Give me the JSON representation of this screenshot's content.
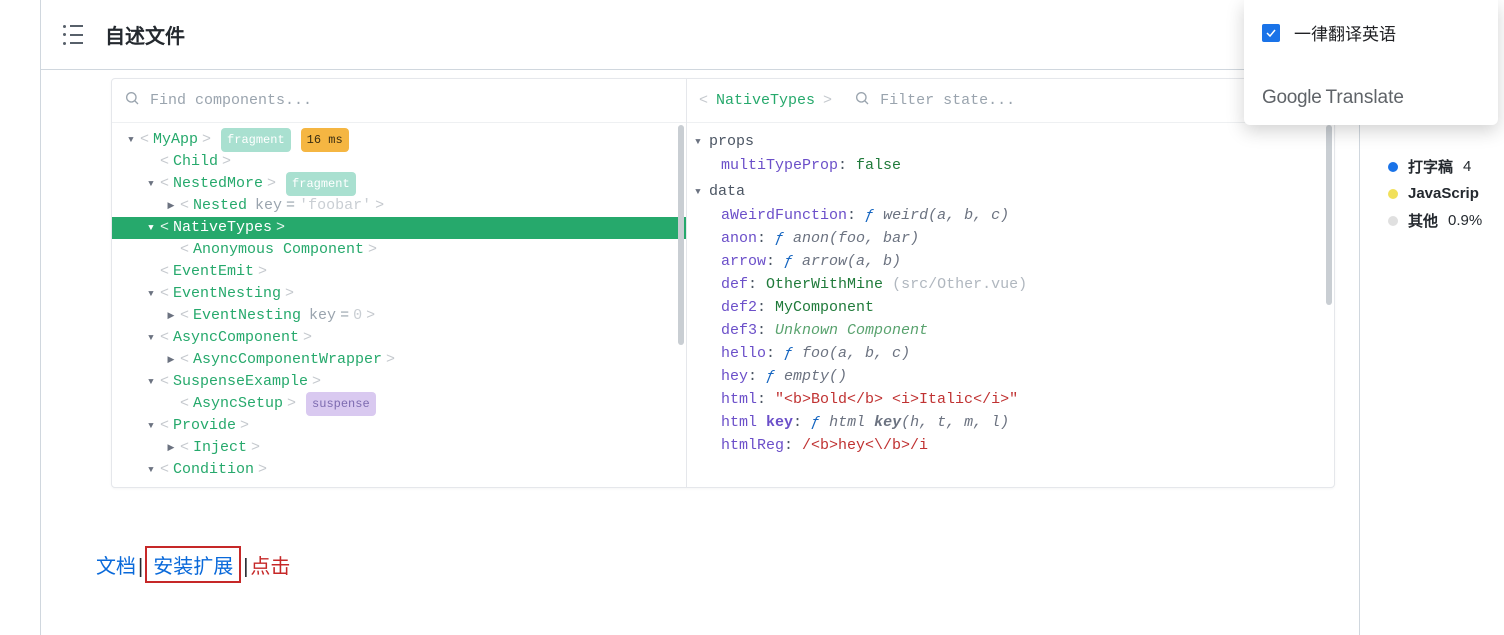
{
  "header": {
    "title": "自述文件"
  },
  "devtools": {
    "left": {
      "search_placeholder": "Find components...",
      "tree": [
        {
          "depth": 0,
          "caret": "down",
          "name": "MyApp",
          "badges": [
            {
              "t": "frag",
              "label": "fragment"
            },
            {
              "t": "ms",
              "label": "16 ms"
            }
          ]
        },
        {
          "depth": 1,
          "caret": "",
          "name": "Child"
        },
        {
          "depth": 1,
          "caret": "down",
          "name": "NestedMore",
          "badges": [
            {
              "t": "frag",
              "label": "fragment"
            }
          ]
        },
        {
          "depth": 2,
          "caret": "right",
          "name": "Nested",
          "keylbl": "key",
          "keyval": "'foobar'"
        },
        {
          "depth": 1,
          "caret": "down",
          "name": "NativeTypes",
          "selected": true
        },
        {
          "depth": 2,
          "caret": "",
          "name": "Anonymous Component"
        },
        {
          "depth": 1,
          "caret": "",
          "name": "EventEmit"
        },
        {
          "depth": 1,
          "caret": "down",
          "name": "EventNesting"
        },
        {
          "depth": 2,
          "caret": "right",
          "name": "EventNesting",
          "keylbl": "key",
          "keyeq": "=",
          "keyval": "0"
        },
        {
          "depth": 1,
          "caret": "down",
          "name": "AsyncComponent"
        },
        {
          "depth": 2,
          "caret": "right",
          "name": "AsyncComponentWrapper"
        },
        {
          "depth": 1,
          "caret": "down",
          "name": "SuspenseExample"
        },
        {
          "depth": 2,
          "caret": "",
          "name": "AsyncSetup",
          "badges": [
            {
              "t": "susp",
              "label": "suspense"
            }
          ]
        },
        {
          "depth": 1,
          "caret": "down",
          "name": "Provide"
        },
        {
          "depth": 2,
          "caret": "right",
          "name": "Inject"
        },
        {
          "depth": 1,
          "caret": "down",
          "name": "Condition"
        }
      ]
    },
    "right": {
      "selected": "NativeTypes",
      "filter_placeholder": "Filter state...",
      "sections": {
        "props": {
          "label": "props",
          "items": [
            {
              "key": "multiTypeProp",
              "kind": "bool",
              "val": "false"
            }
          ]
        },
        "data": {
          "label": "data",
          "items": [
            {
              "key": "aWeirdFunction",
              "kind": "fn",
              "sig": "weird(a, b, c)"
            },
            {
              "key": "anon",
              "kind": "fn",
              "sig": "anon(foo, bar)"
            },
            {
              "key": "arrow",
              "kind": "fn",
              "sig": "arrow(a, b)"
            },
            {
              "key": "def",
              "kind": "def",
              "val": "OtherWithMine",
              "path": "(src/Other.vue)"
            },
            {
              "key": "def2",
              "kind": "def",
              "val": "MyComponent"
            },
            {
              "key": "def3",
              "kind": "unk",
              "val": "Unknown Component"
            },
            {
              "key": "hello",
              "kind": "fn",
              "sig": "foo(a, b, c)"
            },
            {
              "key": "hey",
              "kind": "fn",
              "sig": "empty()"
            },
            {
              "key": "html",
              "kind": "str",
              "val": "\"<b>Bold</b> <i>Italic</i>\""
            },
            {
              "key_html": "html <b>key</b>",
              "kind": "fn",
              "sig_html": "html <b>key</b>(h, t, m, l)"
            },
            {
              "key": "htmlReg",
              "kind": "reg",
              "val": "/<b>hey<\\/b>/i"
            }
          ]
        }
      }
    }
  },
  "links": {
    "doc": "文档",
    "sep1": "|",
    "install": "安装扩展",
    "sep2": "|",
    "click": "点击"
  },
  "translate": {
    "option": "一律翻译英语",
    "logo_g": "Google",
    "logo_t": "Translate"
  },
  "sidebar_legend": [
    {
      "color": "#1a73e8",
      "label": "打字稿",
      "pct": "4"
    },
    {
      "color": "#f1e05a",
      "label": "JavaScrip"
    },
    {
      "color": "#e0e0e0",
      "label": "其他",
      "pct": "0.9%"
    }
  ]
}
